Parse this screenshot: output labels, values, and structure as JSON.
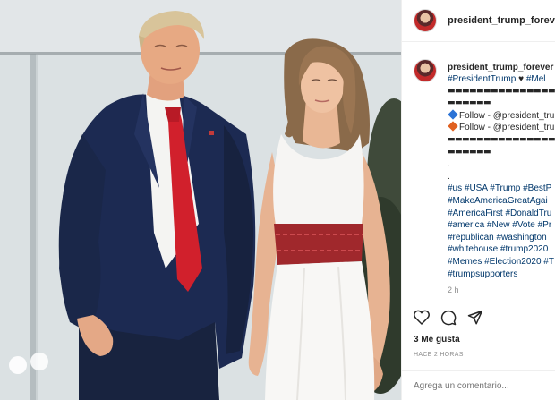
{
  "post": {
    "username": "president_trump_forever",
    "caption_lines": [
      {
        "kind": "text",
        "parts": [
          [
            "tag",
            "#PresidentTrump"
          ],
          [
            "heart",
            " ♥ "
          ],
          [
            "tag",
            "#Mel"
          ]
        ]
      },
      {
        "kind": "dash",
        "text": "▬▬▬▬▬▬▬▬▬▬▬▬▬▬▬"
      },
      {
        "kind": "dash",
        "text": "▬▬▬▬▬▬"
      },
      {
        "kind": "follow",
        "color": "blue",
        "text": "Follow - @president_tru"
      },
      {
        "kind": "follow",
        "color": "orange",
        "text": "Follow - @president_tru"
      },
      {
        "kind": "dash",
        "text": "▬▬▬▬▬▬▬▬▬▬▬▬▬▬▬"
      },
      {
        "kind": "dash",
        "text": "▬▬▬▬▬▬"
      },
      {
        "kind": "plain",
        "text": "."
      },
      {
        "kind": "plain",
        "text": "."
      },
      {
        "kind": "text",
        "parts": [
          [
            "tag",
            "#us #USA #Trump #BestP"
          ]
        ]
      },
      {
        "kind": "text",
        "parts": [
          [
            "tag",
            "#MakeAmericaGreatAgai"
          ]
        ]
      },
      {
        "kind": "text",
        "parts": [
          [
            "tag",
            "#AmericaFirst #DonaldTru"
          ]
        ]
      },
      {
        "kind": "text",
        "parts": [
          [
            "tag",
            "#america #New #Vote #Pr"
          ]
        ]
      },
      {
        "kind": "text",
        "parts": [
          [
            "tag",
            "#republican #washington"
          ]
        ]
      },
      {
        "kind": "text",
        "parts": [
          [
            "tag",
            "#whitehouse #trump2020"
          ]
        ]
      },
      {
        "kind": "text",
        "parts": [
          [
            "tag",
            "#Memes #Election2020 #T"
          ]
        ]
      },
      {
        "kind": "text",
        "parts": [
          [
            "tag",
            "#trumpsupporters"
          ]
        ]
      }
    ],
    "time": "2 h",
    "likes": "3 Me gusta",
    "posted_ago": "HACE 2 HORAS",
    "comment_placeholder": "Agrega un comentario..."
  },
  "icons": {
    "like": "heart-outline-icon",
    "comment": "speech-bubble-icon",
    "share": "paper-plane-icon"
  },
  "colors": {
    "hashtag": "#00376b",
    "muted": "#8e8e8e",
    "text": "#262626"
  }
}
